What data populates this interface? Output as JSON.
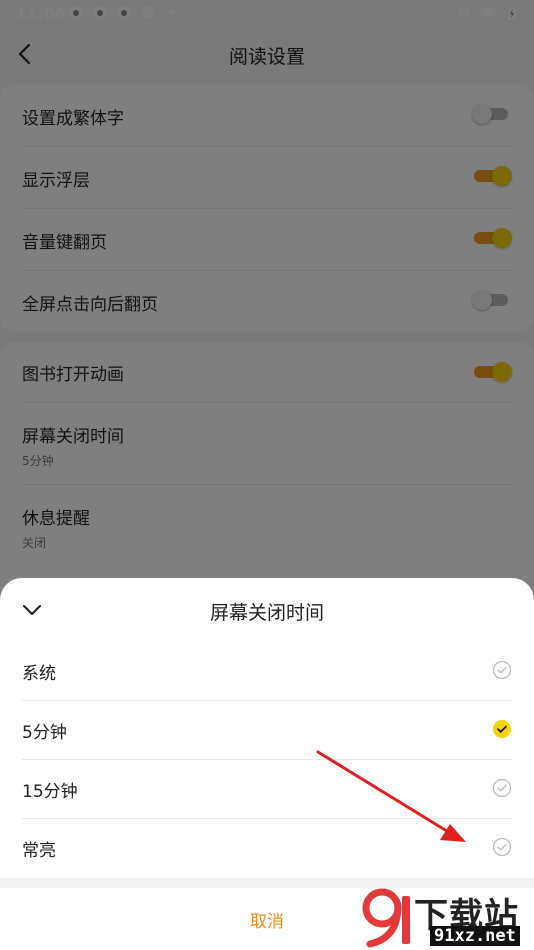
{
  "status_bar": {
    "time": "11:06"
  },
  "header": {
    "title": "阅读设置"
  },
  "settings_group1": [
    {
      "label": "设置成繁体字",
      "enabled": false
    },
    {
      "label": "显示浮层",
      "enabled": true
    },
    {
      "label": "音量键翻页",
      "enabled": true
    },
    {
      "label": "全屏点击向后翻页",
      "enabled": false
    }
  ],
  "settings_group2": {
    "book_animation": {
      "label": "图书打开动画",
      "enabled": true
    },
    "screen_off": {
      "label": "屏幕关闭时间",
      "value": "5分钟"
    },
    "rest_reminder": {
      "label": "休息提醒",
      "value": "关闭"
    }
  },
  "sheet": {
    "title": "屏幕关闭时间",
    "options": [
      {
        "label": "系统",
        "selected": false
      },
      {
        "label": "5分钟",
        "selected": true
      },
      {
        "label": "15分钟",
        "selected": false
      },
      {
        "label": "常亮",
        "selected": false
      }
    ],
    "cancel_label": "取消"
  },
  "watermark": {
    "logo_text": "下载站",
    "site": "91xz.net"
  },
  "colors": {
    "accent": "#f08c14",
    "toggle_on_track": "#f29b1f",
    "toggle_on_knob": "#f7d20e",
    "check_selected": "#f7d20e",
    "arrow": "#e02020"
  }
}
